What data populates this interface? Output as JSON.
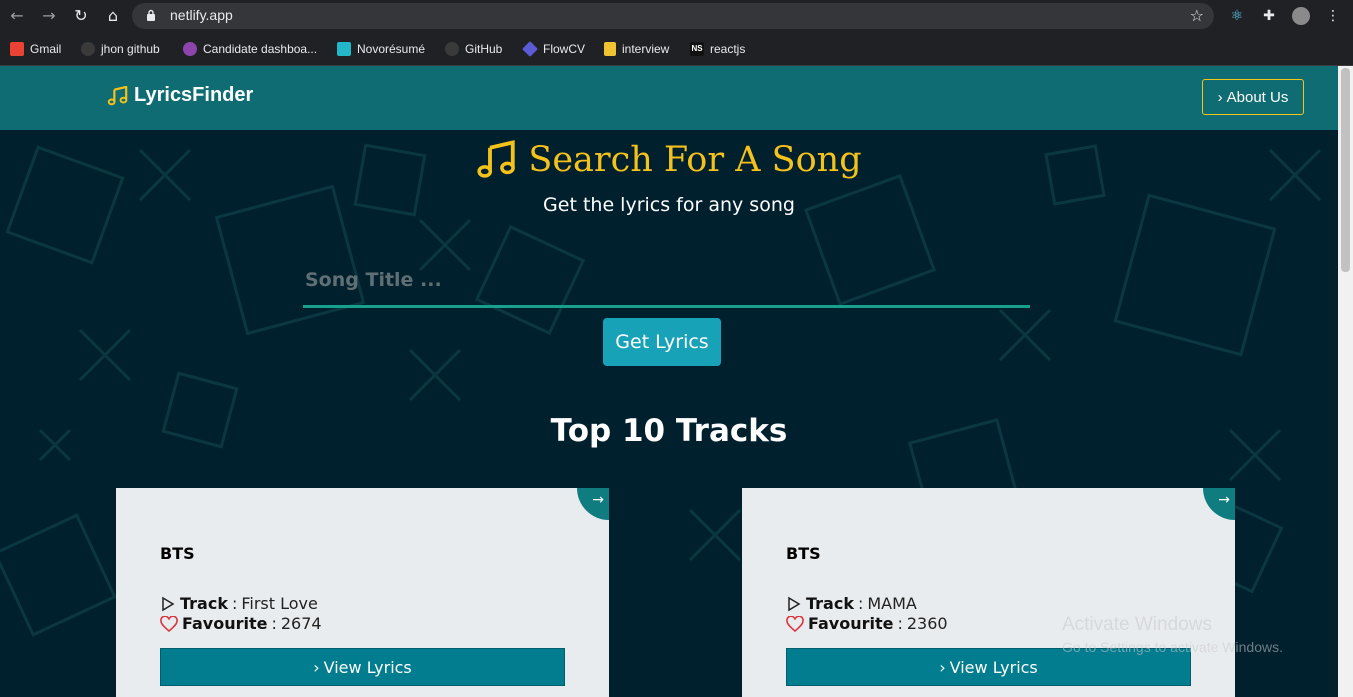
{
  "browser": {
    "url": "netlify.app",
    "bookmarks": [
      {
        "label": "Gmail",
        "color": "#ea4335"
      },
      {
        "label": "jhon github",
        "color": "#6e6e6e"
      },
      {
        "label": "Candidate dashboa...",
        "color": "#8e44ad"
      },
      {
        "label": "Novorésumé",
        "color": "#22b8c9"
      },
      {
        "label": "GitHub",
        "color": "#6e6e6e"
      },
      {
        "label": "FlowCV",
        "color": "#5b5bd6"
      },
      {
        "label": "interview",
        "color": "#f1c232"
      },
      {
        "label": "reactjs",
        "color": "#111111"
      }
    ]
  },
  "header": {
    "logo": "LyricsFinder",
    "about_label": "About Us"
  },
  "hero": {
    "title": "Search For A Song",
    "subtitle": "Get the lyrics for any song",
    "search_placeholder": "Song Title ...",
    "button_label": "Get Lyrics"
  },
  "tracks_section": {
    "title": "Top 10 Tracks",
    "track_label": "Track",
    "favourite_label": "Favourite",
    "view_label": "View Lyrics",
    "cards": [
      {
        "artist": "BTS",
        "track": "First Love",
        "favourite": "2674"
      },
      {
        "artist": "BTS",
        "track": "MAMA",
        "favourite": "2360"
      }
    ]
  },
  "watermark": {
    "line1": "Activate Windows",
    "line2": "Go to Settings to activate Windows."
  },
  "colors": {
    "header": "#0f6c73",
    "accent_yellow": "#f4c21b",
    "button_teal": "#17a2b8",
    "view_button": "#017d8f",
    "background": "#00202e"
  }
}
